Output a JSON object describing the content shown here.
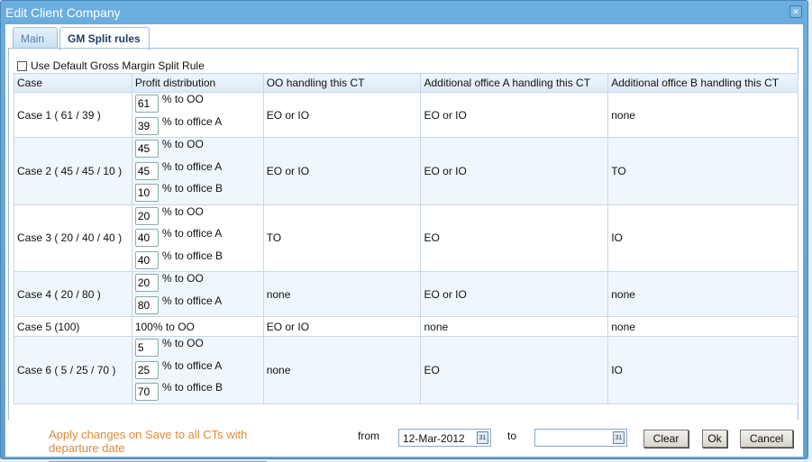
{
  "window": {
    "title": "Edit Client Company",
    "close_icon": "close-icon"
  },
  "tabs": [
    {
      "label": "Main"
    },
    {
      "label": "GM Split rules"
    }
  ],
  "default_rule_checkbox": {
    "label": "Use Default Gross Margin Split Rule",
    "checked": false
  },
  "table": {
    "headers": [
      "Case",
      "Profit distribution",
      "OO handling this CT",
      "Additional office A handling this CT",
      "Additional office B handling this CT"
    ],
    "rows": [
      {
        "case": "Case 1 ( 61 / 39 )",
        "distribution": [
          {
            "value": "61",
            "label": "% to OO"
          },
          {
            "value": "39",
            "label": "% to office A"
          }
        ],
        "oo": "EO or IO",
        "office_a": "EO or IO",
        "office_b": "none"
      },
      {
        "case": "Case 2 ( 45 / 45 / 10 )",
        "distribution": [
          {
            "value": "45",
            "label": "% to OO"
          },
          {
            "value": "45",
            "label": "% to office A"
          },
          {
            "value": "10",
            "label": "% to office B"
          }
        ],
        "oo": "EO or IO",
        "office_a": "EO or IO",
        "office_b": "TO"
      },
      {
        "case": "Case 3 ( 20 / 40 / 40 )",
        "distribution": [
          {
            "value": "20",
            "label": "% to OO"
          },
          {
            "value": "40",
            "label": "% to office A"
          },
          {
            "value": "40",
            "label": "% to office B"
          }
        ],
        "oo": "TO",
        "office_a": "EO",
        "office_b": "IO"
      },
      {
        "case": "Case 4 ( 20 / 80 )",
        "distribution": [
          {
            "value": "20",
            "label": "% to OO"
          },
          {
            "value": "80",
            "label": "% to office A"
          }
        ],
        "oo": "none",
        "office_a": "EO or IO",
        "office_b": "none"
      },
      {
        "case": "Case 5 (100)",
        "distribution_text": "100% to OO",
        "oo": "EO or IO",
        "office_a": "none",
        "office_b": "none"
      },
      {
        "case": "Case 6 ( 5 / 25 / 70 )",
        "distribution": [
          {
            "value": "5",
            "label": "% to OO"
          },
          {
            "value": "25",
            "label": "% to office A"
          },
          {
            "value": "70",
            "label": "% to office B"
          }
        ],
        "oo": "none",
        "office_a": "EO",
        "office_b": "IO"
      }
    ]
  },
  "footer": {
    "apply_text": "Apply changes on Save to  all CTs with  departure date",
    "from_label": "from",
    "from_date": "12-Mar-2012",
    "to_label": "to",
    "to_date": "",
    "calendar_icon": "calendar-icon",
    "calendar_glyph": "31",
    "clear": "Clear",
    "ok": "Ok",
    "cancel": "Cancel"
  },
  "colors": {
    "title_bar": "#5d9fd4",
    "apply_text": "#e08a3a",
    "alt_row": "#f0f7fc"
  }
}
